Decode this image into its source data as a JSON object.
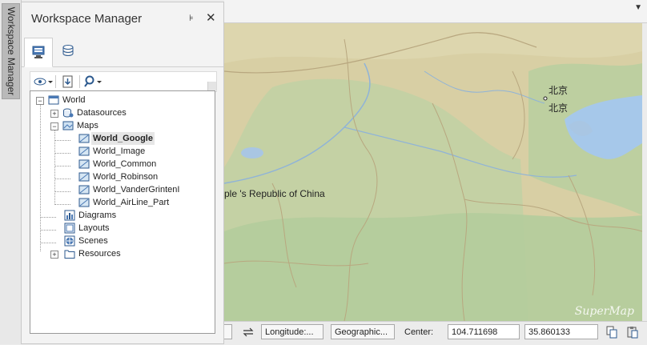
{
  "vertical_tab": {
    "label": "Workspace Manager"
  },
  "panel": {
    "title": "Workspace Manager",
    "pin_icon": "pin-icon",
    "close_icon": "close-icon",
    "tabs": [
      {
        "name": "workspace-tree-tab",
        "icon": "workspace-icon",
        "active": true
      },
      {
        "name": "datasource-tab",
        "icon": "database-icon",
        "active": false
      }
    ]
  },
  "toolbar": {
    "items": [
      "visibility-icon",
      "export-icon",
      "search-icon"
    ]
  },
  "tree": {
    "root": "World",
    "datasources": "Datasources",
    "maps": "Maps",
    "map_items": [
      "World_Google",
      "World_Image",
      "World_Common",
      "World_Robinson",
      "World_VanderGrintenI",
      "World_AirLine_Part"
    ],
    "selected_index": 0,
    "diagrams": "Diagrams",
    "layouts": "Layouts",
    "scenes": "Scenes",
    "resources": "Resources"
  },
  "map": {
    "labels": {
      "beijing_1": "北京",
      "beijing_2": "北京",
      "country": "ple 's Republic of China"
    },
    "watermark": "SuperMap",
    "colors": {
      "land": "#d9d1a6",
      "green": "#b7cfa0",
      "water": "#a9c6e3",
      "sea": "#a6c8ea"
    }
  },
  "status": {
    "projection_toggle_icon": "swap-icon",
    "longitude": "Longitude:...",
    "coord_system": "Geographic...",
    "center_label": "Center:",
    "center_x": "104.711698",
    "center_y": "35.860133",
    "copy_icon": "copy-icon",
    "paste_icon": "paste-icon"
  }
}
